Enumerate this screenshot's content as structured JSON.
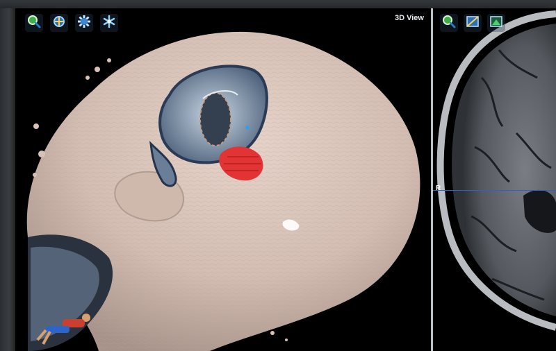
{
  "viewport_3d": {
    "label": "3D View",
    "tools": [
      {
        "name": "zoom-icon"
      },
      {
        "name": "rotate-icon"
      },
      {
        "name": "settings-gear-icon"
      },
      {
        "name": "snowflake-icon"
      }
    ]
  },
  "viewport_mri": {
    "orientation_marker": "R",
    "tools": [
      {
        "name": "zoom-icon"
      },
      {
        "name": "layout-icon"
      },
      {
        "name": "layout-alt-icon"
      }
    ]
  },
  "colors": {
    "skin": "#d8c3b8",
    "tumor": "#e23434",
    "crosshair": "#2f5fd0",
    "divider": "#b9c0c6"
  }
}
